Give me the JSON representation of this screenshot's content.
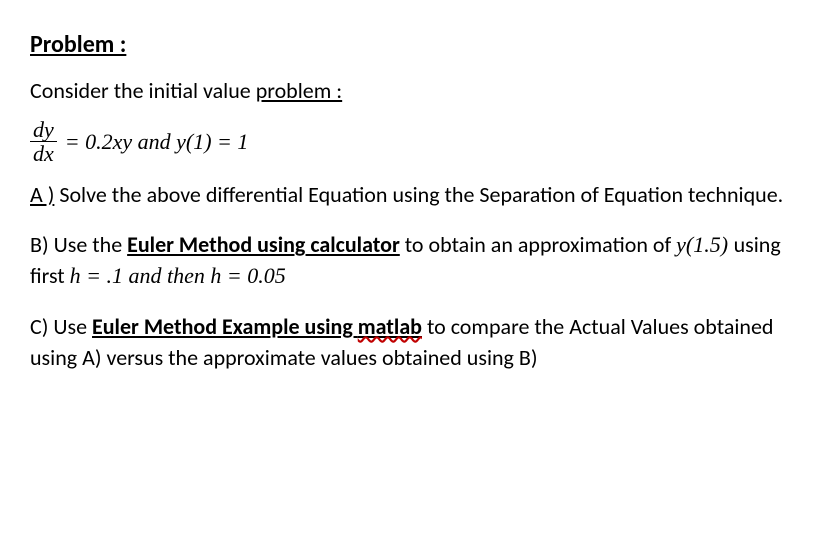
{
  "heading": "Problem :",
  "intro_prefix": "Consider the initial value ",
  "intro_link": "problem :",
  "equation": {
    "numerator": "dy",
    "denominator": "dx",
    "rhs": "= 0.2xy and y(1) = 1"
  },
  "partA": {
    "label": "A )",
    "text_after_label": " Solve the above differential Equation using the Separation of Equation technique."
  },
  "partB": {
    "label": "B) ",
    "prefix": "Use the ",
    "link": "Euler Method using calculator",
    "after_link": " to obtain an approximation of ",
    "eq1": "y(1.5) ",
    "mid1": "using first ",
    "eq2": "h = .1  and then h = 0.05"
  },
  "partC": {
    "label": "C) ",
    "prefix": "Use ",
    "link_part1": "Euler Method Example using ",
    "link_wavy": "matlab",
    "after_link": " to compare the Actual Values obtained using A) versus the approximate values obtained using B)"
  }
}
